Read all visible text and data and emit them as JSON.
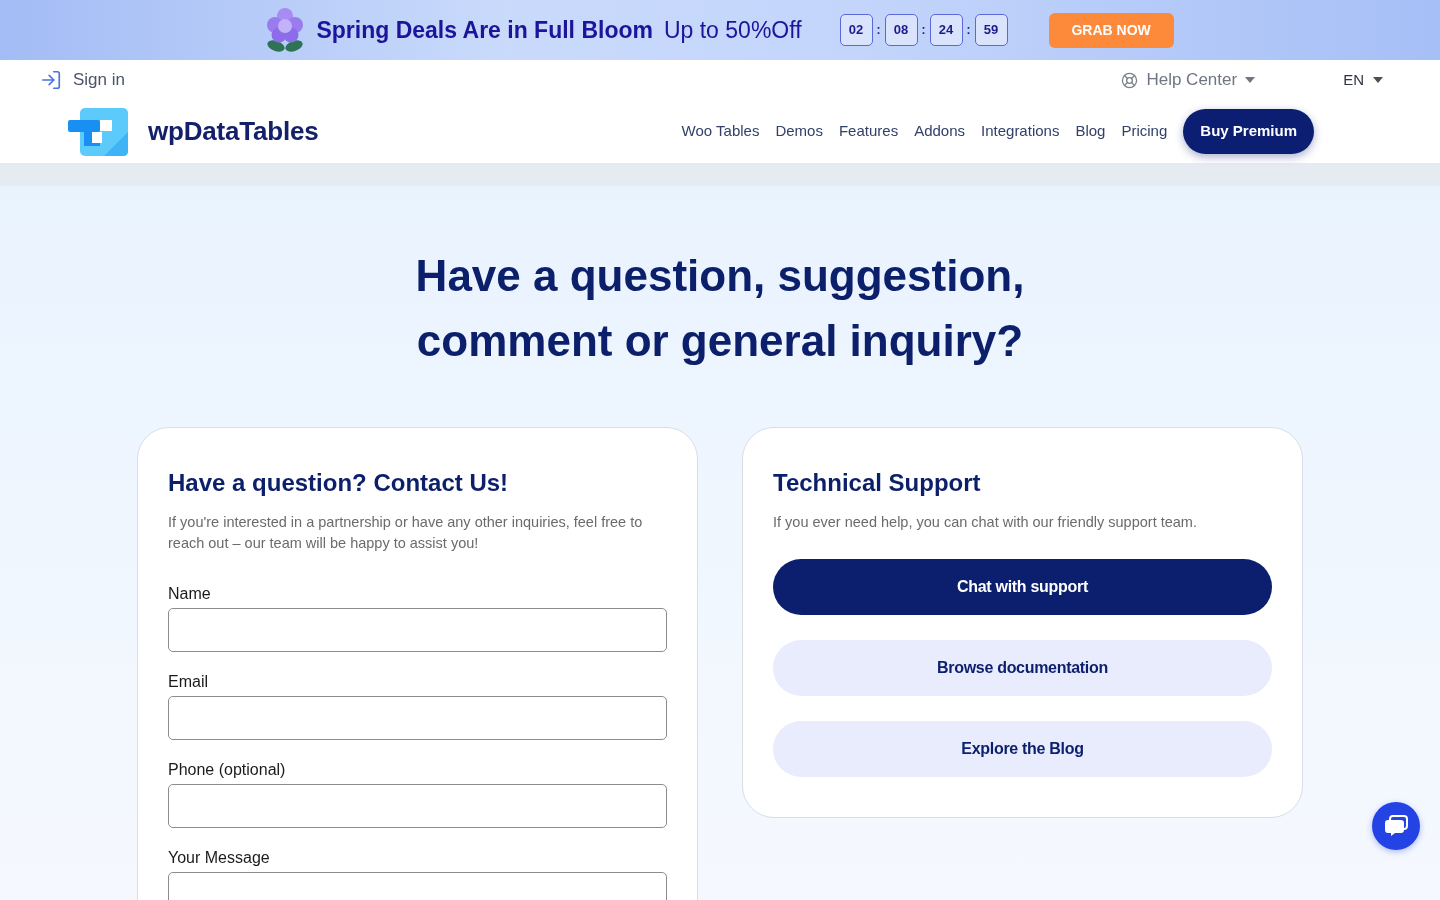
{
  "promo_bar": {
    "headline": "Spring Deals Are in Full Bloom",
    "offer": "Up to 50%Off",
    "countdown": {
      "units": [
        "02",
        "08",
        "24",
        "59"
      ],
      "separators": [
        ":",
        ":",
        ":"
      ]
    },
    "button": "GRAB NOW"
  },
  "top_bar": {
    "sign_in": "Sign in",
    "help_center": "Help Center",
    "language": "EN"
  },
  "header": {
    "logo_text": "wpDataTables",
    "nav": [
      "Woo Tables",
      "Demos",
      "Features",
      "Addons",
      "Integrations",
      "Blog",
      "Pricing"
    ],
    "cta": "Buy Premium"
  },
  "hero": {
    "title": "Have a question, suggestion, comment or general inquiry?"
  },
  "contact_card": {
    "title": "Have a question? Contact Us!",
    "description": "If you're interested in a partnership or have any other inquiries, feel free to reach out – our team will be happy to assist you!",
    "fields": [
      {
        "label": "Name",
        "kind": "input"
      },
      {
        "label": "Email",
        "kind": "input"
      },
      {
        "label": "Phone (optional)",
        "kind": "input"
      },
      {
        "label": "Your Message",
        "kind": "textarea"
      }
    ]
  },
  "support_card": {
    "title": "Technical Support",
    "description": "If you ever need help, you can chat with our friendly support team.",
    "buttons": [
      {
        "label": "Chat with support",
        "kind": "primary"
      },
      {
        "label": "Browse documentation",
        "kind": "secondary"
      },
      {
        "label": "Explore the Blog",
        "kind": "secondary"
      }
    ]
  }
}
